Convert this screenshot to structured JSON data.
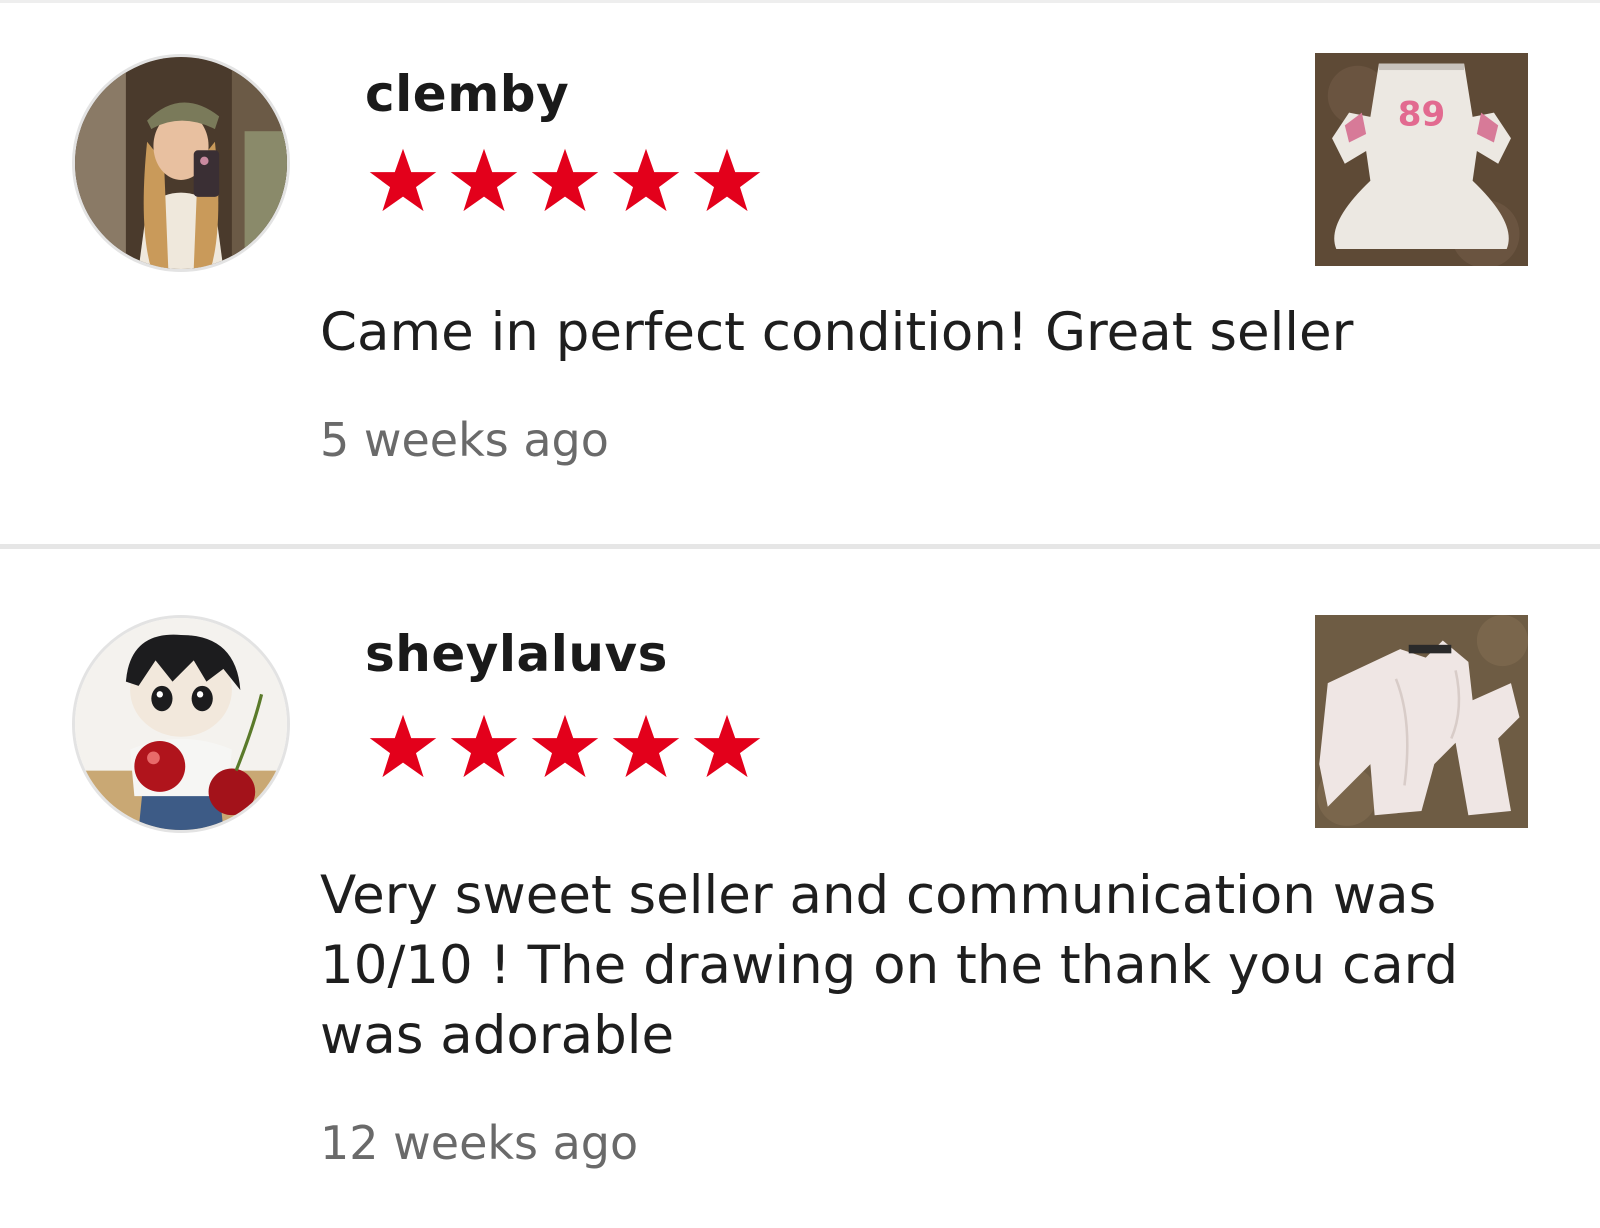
{
  "colors": {
    "star": "#e3001b",
    "divider": "#e6e6e6",
    "timestamp": "#6a6a6a"
  },
  "reviews": [
    {
      "username": "clemby",
      "rating": 5,
      "rating_max": 5,
      "comment": "Came in perfect condition! Great seller",
      "timestamp": "5 weeks ago",
      "item_icon": "white-top-photo"
    },
    {
      "username": "sheylaluvs",
      "rating": 5,
      "rating_max": 5,
      "comment": "Very sweet seller and communication was 10/10 ! The drawing on the thank you card was adorable",
      "timestamp": "12 weeks ago",
      "item_icon": "white-pants-photo"
    }
  ]
}
